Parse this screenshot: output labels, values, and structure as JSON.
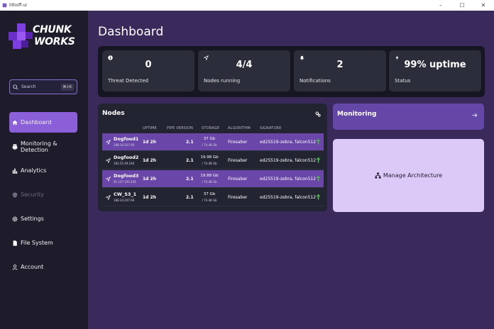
{
  "window": {
    "title": "lithoff-ui",
    "minimize": "–",
    "maximize": "☐",
    "close": "✕"
  },
  "brand": {
    "line1": "CHUNK",
    "line2": "WORKS"
  },
  "search": {
    "placeholder": "Search",
    "shortcut": "⌘+K"
  },
  "sidebar": {
    "items": [
      {
        "label": "Dashboard",
        "icon": "home-icon",
        "active": true
      },
      {
        "label": "Monitoring & Detection",
        "icon": "monitor-icon"
      },
      {
        "label": "Analytics",
        "icon": "chart-icon"
      },
      {
        "label": "Security",
        "icon": "shield-icon",
        "disabled": true
      },
      {
        "label": "Settings",
        "icon": "gear-icon"
      },
      {
        "label": "File System",
        "icon": "file-icon"
      },
      {
        "label": "Account",
        "icon": "user-icon"
      }
    ]
  },
  "page": {
    "title": "Dashboard"
  },
  "stats": [
    {
      "value": "0",
      "label": "Threat Detected",
      "icon": "info-icon"
    },
    {
      "value": "4/4",
      "label": "Nodes running",
      "icon": "navigation-icon"
    },
    {
      "value": "2",
      "label": "Notifications",
      "icon": "bell-icon"
    },
    {
      "value": "99% uptime",
      "label": "Status",
      "icon": "lightning-icon"
    }
  ],
  "nodes": {
    "title": "Nodes",
    "columns": {
      "uptime": "UPTIME",
      "pipe": "PIPE VERSION",
      "storage": "STORAGE",
      "algorithm": "ALGORITHM",
      "signature": "SIGNATURE"
    },
    "rows": [
      {
        "name": "Dogfood1",
        "ip": "188.34.207.69",
        "uptime": "1d 2h",
        "pipe": "2.1",
        "storage": "37 Gb",
        "storage_total": "/ 74.48 Gb",
        "algorithm": "Firesaber",
        "signature": "ed25519-zebra, falcon512",
        "highlight": true
      },
      {
        "name": "Dogfood2",
        "ip": "162.55.49.146",
        "uptime": "1d 2h",
        "pipe": "2.1",
        "storage": "19.98 Gb",
        "storage_total": "/ 74.48 Gb",
        "algorithm": "Firesaber",
        "signature": "ed25519-zebra, falcon512",
        "highlight": false
      },
      {
        "name": "Dogfood3",
        "ip": "91.107.192.246",
        "uptime": "1d 2h",
        "pipe": "2.1",
        "storage": "19.88 Gb",
        "storage_total": "/ 74.48 Gb",
        "algorithm": "Firesaber",
        "signature": "ed25519-zebra, falcon512",
        "highlight": true
      },
      {
        "name": "CW_S3_1",
        "ip": "188.34.207.69",
        "uptime": "1d 2h",
        "pipe": "2.1",
        "storage": "37 Gb",
        "storage_total": "/ 74.48 Gb",
        "algorithm": "Firesaber",
        "signature": "ed25519-zebra, falcon512",
        "highlight": false
      }
    ]
  },
  "monitoring": {
    "title": "Monitoring"
  },
  "architecture": {
    "label": "Manage Architecture"
  },
  "colors": {
    "accent": "#8a5fd8",
    "background": "#3a2a5c",
    "sidebar": "#1e1c2a",
    "status_up": "#4caf50"
  }
}
